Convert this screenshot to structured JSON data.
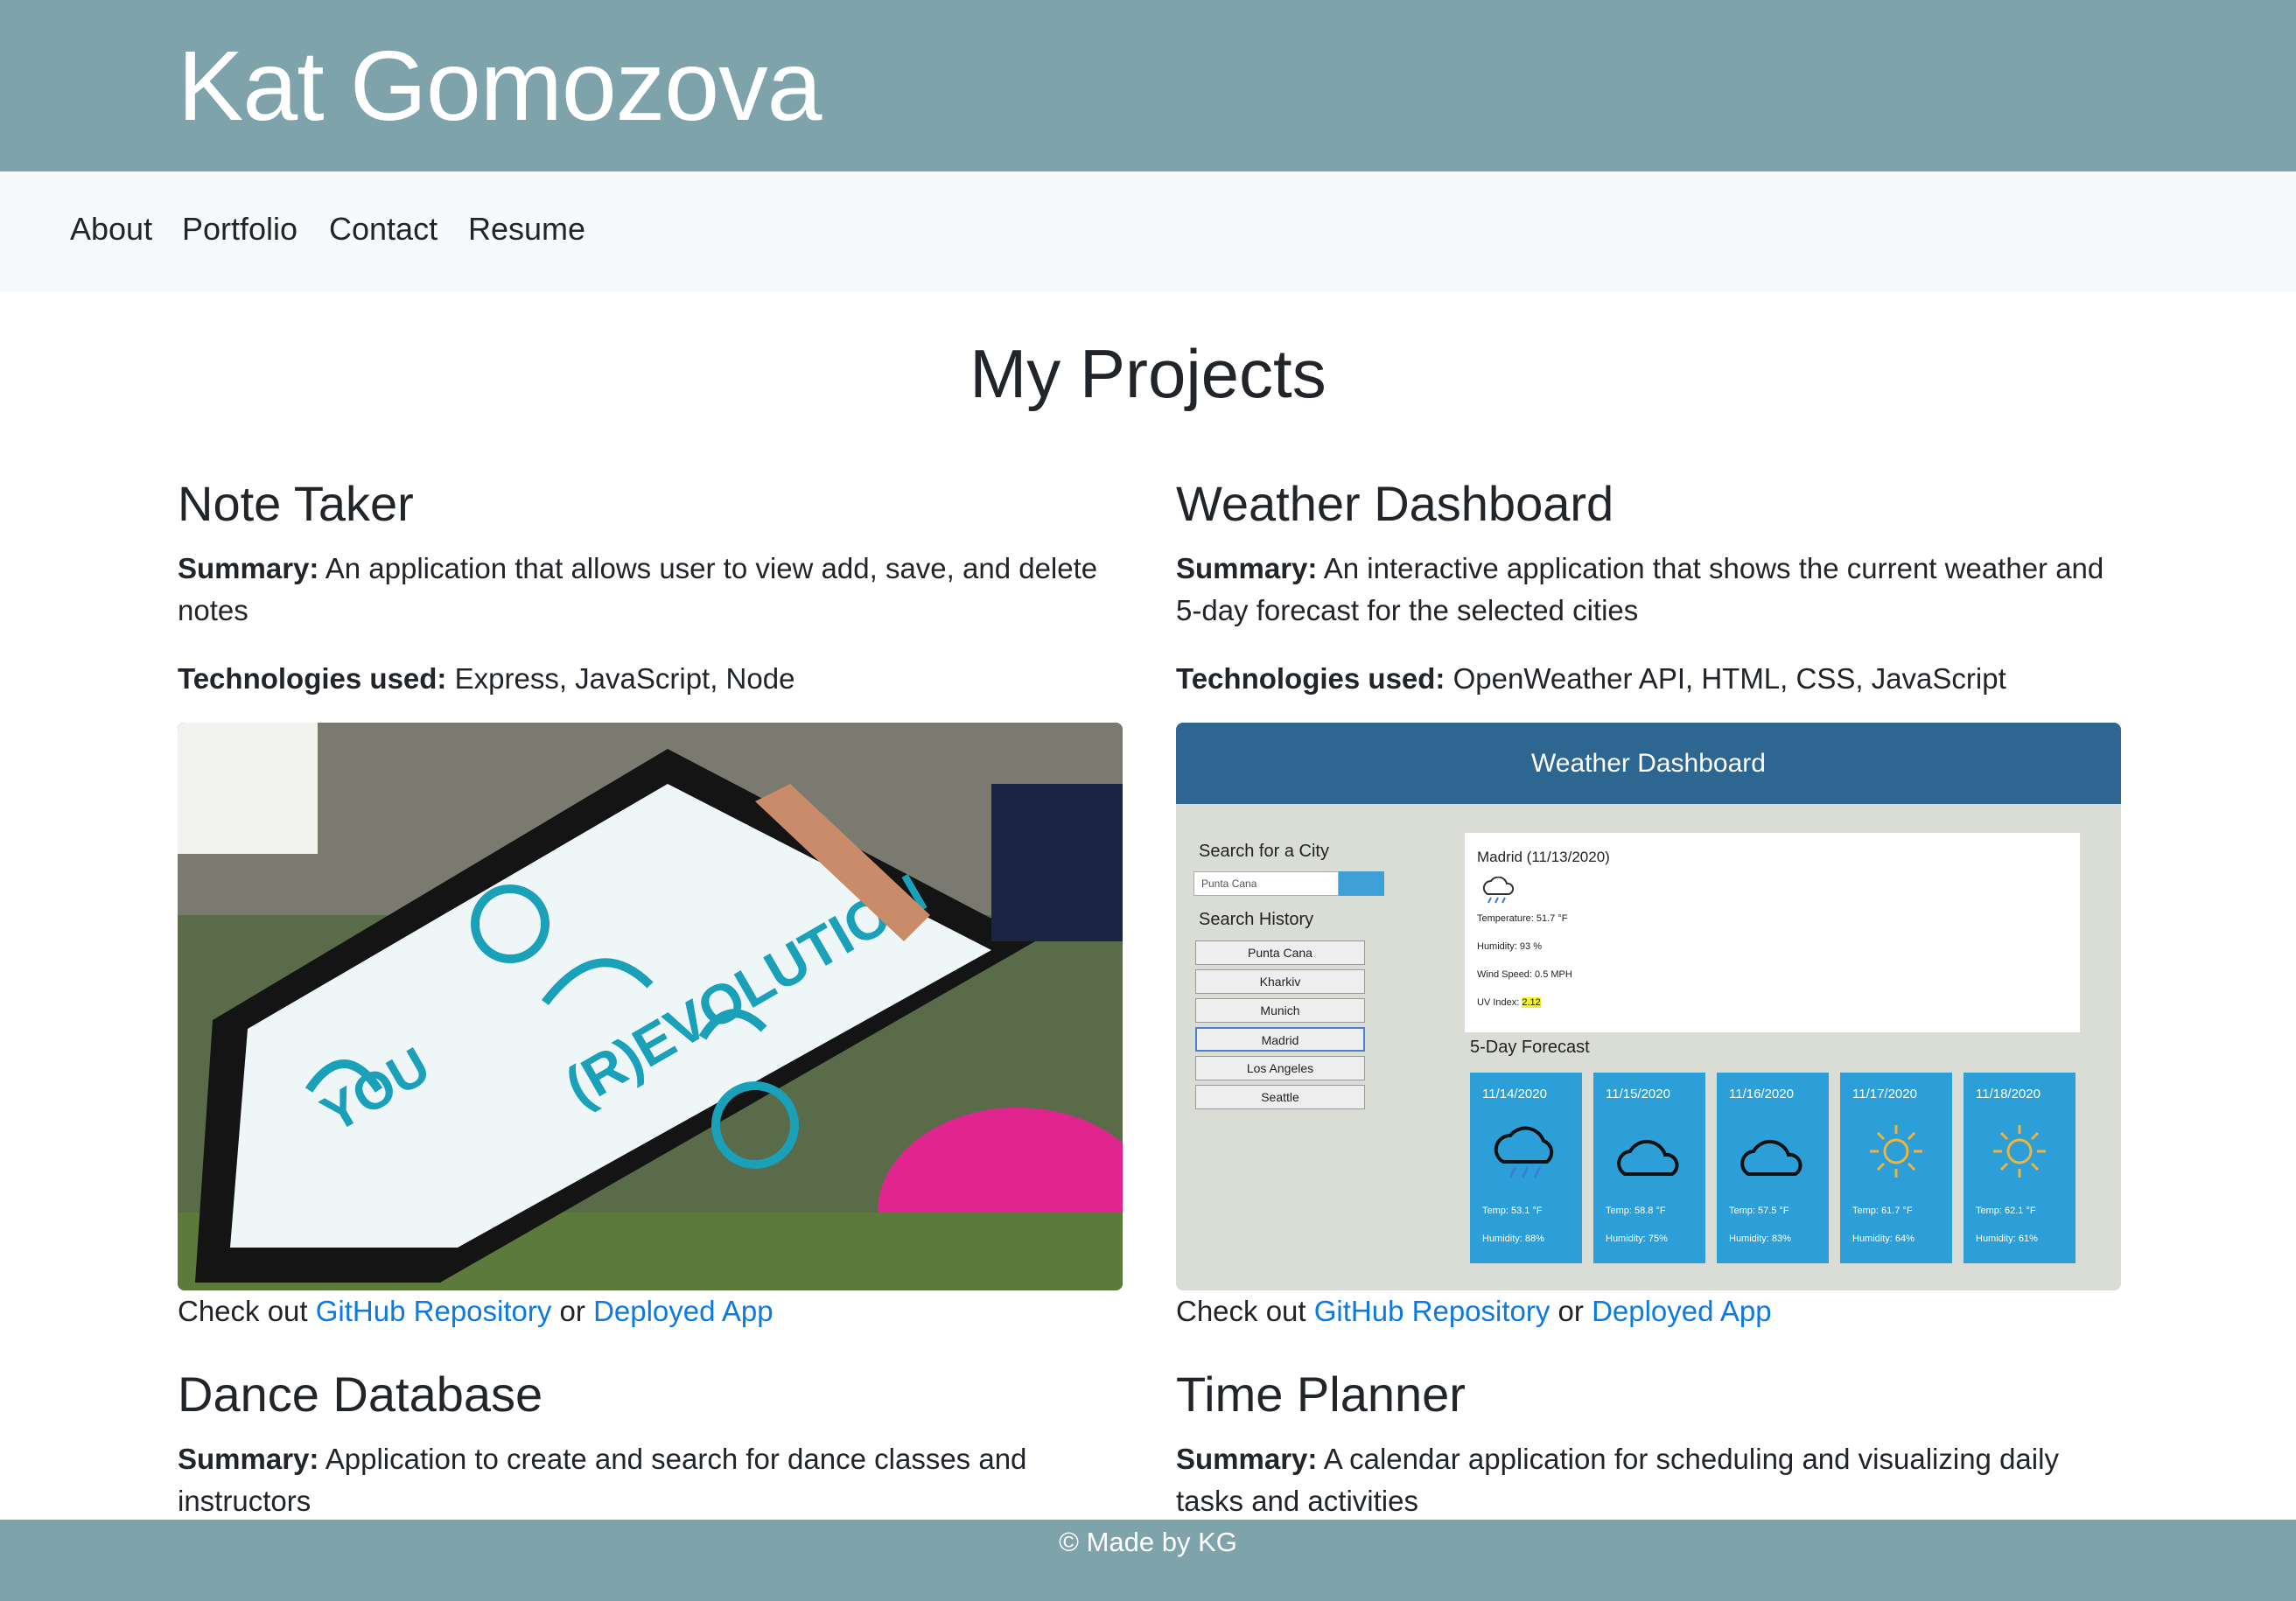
{
  "header": {
    "title": "Kat Gomozova"
  },
  "nav": {
    "items": [
      "About",
      "Portfolio",
      "Contact",
      "Resume"
    ]
  },
  "main": {
    "title": "My Projects",
    "projects": [
      {
        "name": "Note Taker",
        "summary_label": "Summary:",
        "summary": "An application that allows user to view add, save, and delete notes",
        "tech_label": "Technologies used:",
        "tech": "Express, JavaScript, Node",
        "links_prefix": "Check out",
        "repo_link": "GitHub Repository",
        "or": "or",
        "app_link": "Deployed App"
      },
      {
        "name": "Weather Dashboard",
        "summary_label": "Summary:",
        "summary": "An interactive application that shows the current weather and 5-day forecast for the selected cities",
        "tech_label": "Technologies used:",
        "tech": "OpenWeather API, HTML, CSS, JavaScript",
        "links_prefix": "Check out",
        "repo_link": "GitHub Repository",
        "or": "or",
        "app_link": "Deployed App"
      },
      {
        "name": "Dance Database",
        "summary_label": "Summary:",
        "summary": "Application to create and search for dance classes and instructors"
      },
      {
        "name": "Time Planner",
        "summary_label": "Summary:",
        "summary": "A calendar application for scheduling and visualizing daily tasks and activities"
      }
    ]
  },
  "weather_preview": {
    "title": "Weather Dashboard",
    "search_label": "Search for a City",
    "search_value": "Punta Cana",
    "history_label": "Search History",
    "history": [
      "Punta Cana",
      "Kharkiv",
      "Munich",
      "Madrid",
      "Los Angeles",
      "Seattle"
    ],
    "current_city": "Madrid (11/13/2020)",
    "temperature": "Temperature: 51.7 °F",
    "humidity": "Humidity: 93 %",
    "wind": "Wind Speed: 0.5 MPH",
    "uv_label": "UV Index:",
    "uv_value": "2.12",
    "forecast_label": "5-Day Forecast",
    "forecast": [
      {
        "date": "11/14/2020",
        "icon": "rain-cloud-icon",
        "temp": "Temp: 53.1 °F",
        "humidity": "Humidity: 88%"
      },
      {
        "date": "11/15/2020",
        "icon": "cloud-icon",
        "temp": "Temp: 58.8 °F",
        "humidity": "Humidity: 75%"
      },
      {
        "date": "11/16/2020",
        "icon": "cloud-icon",
        "temp": "Temp: 57.5 °F",
        "humidity": "Humidity: 83%"
      },
      {
        "date": "11/17/2020",
        "icon": "sun-icon",
        "temp": "Temp: 61.7 °F",
        "humidity": "Humidity: 64%"
      },
      {
        "date": "11/18/2020",
        "icon": "sun-icon",
        "temp": "Temp: 62.1 °F",
        "humidity": "Humidity: 61%"
      }
    ]
  },
  "footer": {
    "text": "© Made by KG"
  },
  "colors": {
    "header_bg": "#7fa3aa",
    "nav_bg": "#f8f9fa",
    "link": "#0d7ae4",
    "weather_bar": "#2d6690",
    "forecast_card": "#2d9fd8"
  }
}
